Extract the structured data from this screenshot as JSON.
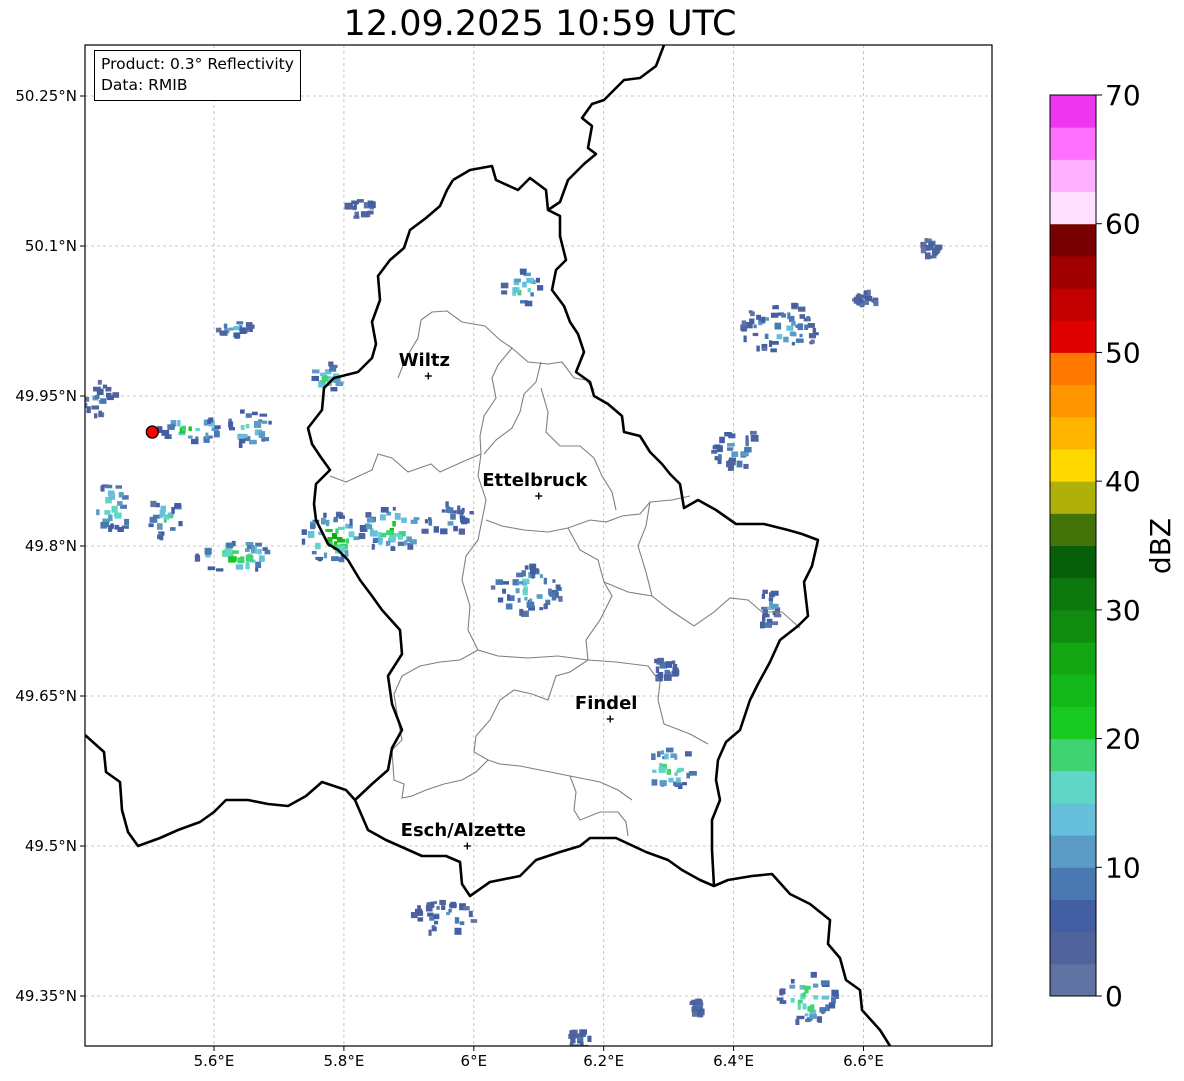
{
  "title": "12.09.2025 10:59 UTC",
  "info": {
    "product": "Product: 0.3° Reflectivity",
    "source": "Data: RMIB"
  },
  "map": {
    "lon_range": [
      5.4,
      6.8
    ],
    "lat_range": [
      49.3,
      50.3
    ],
    "lon_ticks": [
      {
        "value": 5.6,
        "label": "5.6°E"
      },
      {
        "value": 5.8,
        "label": "5.8°E"
      },
      {
        "value": 6.0,
        "label": "6°E"
      },
      {
        "value": 6.2,
        "label": "6.2°E"
      },
      {
        "value": 6.4,
        "label": "6.4°E"
      },
      {
        "value": 6.6,
        "label": "6.6°E"
      }
    ],
    "lat_ticks": [
      {
        "value": 50.25,
        "label": "50.25°N"
      },
      {
        "value": 50.1,
        "label": "50.1°N"
      },
      {
        "value": 49.95,
        "label": "49.95°N"
      },
      {
        "value": 49.8,
        "label": "49.8°N"
      },
      {
        "value": 49.65,
        "label": "49.65°N"
      },
      {
        "value": 49.5,
        "label": "49.5°N"
      },
      {
        "value": 49.35,
        "label": "49.35°N"
      }
    ],
    "grid": true,
    "cities": [
      {
        "name": "Wiltz",
        "lon": 5.93,
        "lat": 49.97
      },
      {
        "name": "Ettelbruck",
        "lon": 6.1,
        "lat": 49.85
      },
      {
        "name": "Findel",
        "lon": 6.21,
        "lat": 49.627
      },
      {
        "name": "Esch/Alzette",
        "lon": 5.99,
        "lat": 49.5
      }
    ],
    "radar_site": {
      "lon": 5.505,
      "lat": 49.914,
      "color": "#ff0000"
    },
    "colors": {
      "border": "#000000",
      "cantons": "#808080",
      "grid": "#bbbbbb"
    }
  },
  "colorbar": {
    "label": "dBZ",
    "min": 0,
    "max": 70,
    "ticks": [
      0,
      10,
      20,
      30,
      40,
      50,
      60,
      70
    ],
    "step": 2.5,
    "colors": [
      "#6173a3",
      "#50639c",
      "#445ea3",
      "#4a78b0",
      "#5a9cc6",
      "#66c0dc",
      "#5fd6c6",
      "#3fd371",
      "#17c920",
      "#13b91a",
      "#12a712",
      "#0f8b0e",
      "#0c780e",
      "#075f0a",
      "#437409",
      "#b0b00a",
      "#ffd800",
      "#ffb400",
      "#ff9600",
      "#ff7800",
      "#e10000",
      "#c30000",
      "#a00000",
      "#780000",
      "#ffe0ff",
      "#ffb0ff",
      "#ff70ff",
      "#ee36ee"
    ]
  },
  "echoes": [
    {
      "lon": 5.42,
      "lat": 49.95,
      "w": 0.05,
      "h": 0.04,
      "intensity": 10
    },
    {
      "lon": 5.56,
      "lat": 49.92,
      "w": 0.1,
      "h": 0.03,
      "intensity": 22
    },
    {
      "lon": 5.65,
      "lat": 49.92,
      "w": 0.08,
      "h": 0.035,
      "intensity": 20
    },
    {
      "lon": 5.63,
      "lat": 50.02,
      "w": 0.06,
      "h": 0.015,
      "intensity": 14
    },
    {
      "lon": 5.77,
      "lat": 49.97,
      "w": 0.05,
      "h": 0.03,
      "intensity": 22
    },
    {
      "lon": 5.44,
      "lat": 49.84,
      "w": 0.06,
      "h": 0.05,
      "intensity": 20
    },
    {
      "lon": 5.52,
      "lat": 49.83,
      "w": 0.06,
      "h": 0.04,
      "intensity": 18
    },
    {
      "lon": 5.63,
      "lat": 49.79,
      "w": 0.12,
      "h": 0.035,
      "intensity": 24
    },
    {
      "lon": 5.78,
      "lat": 49.81,
      "w": 0.1,
      "h": 0.05,
      "intensity": 26
    },
    {
      "lon": 5.87,
      "lat": 49.82,
      "w": 0.1,
      "h": 0.045,
      "intensity": 24
    },
    {
      "lon": 5.96,
      "lat": 49.83,
      "w": 0.08,
      "h": 0.03,
      "intensity": 12
    },
    {
      "lon": 6.07,
      "lat": 50.06,
      "w": 0.06,
      "h": 0.035,
      "intensity": 22
    },
    {
      "lon": 6.08,
      "lat": 49.76,
      "w": 0.11,
      "h": 0.05,
      "intensity": 16
    },
    {
      "lon": 6.47,
      "lat": 50.02,
      "w": 0.12,
      "h": 0.05,
      "intensity": 14
    },
    {
      "lon": 6.4,
      "lat": 49.9,
      "w": 0.08,
      "h": 0.04,
      "intensity": 12
    },
    {
      "lon": 6.45,
      "lat": 49.74,
      "w": 0.03,
      "h": 0.04,
      "intensity": 13
    },
    {
      "lon": 6.3,
      "lat": 49.58,
      "w": 0.08,
      "h": 0.04,
      "intensity": 22
    },
    {
      "lon": 6.29,
      "lat": 49.68,
      "w": 0.04,
      "h": 0.02,
      "intensity": 9
    },
    {
      "lon": 6.7,
      "lat": 50.1,
      "w": 0.03,
      "h": 0.02,
      "intensity": 8
    },
    {
      "lon": 6.6,
      "lat": 50.05,
      "w": 0.04,
      "h": 0.015,
      "intensity": 8
    },
    {
      "lon": 5.95,
      "lat": 49.43,
      "w": 0.1,
      "h": 0.035,
      "intensity": 12
    },
    {
      "lon": 6.51,
      "lat": 49.35,
      "w": 0.09,
      "h": 0.05,
      "intensity": 22
    },
    {
      "lon": 6.34,
      "lat": 49.34,
      "w": 0.02,
      "h": 0.02,
      "intensity": 8
    },
    {
      "lon": 5.82,
      "lat": 50.14,
      "w": 0.05,
      "h": 0.02,
      "intensity": 7
    },
    {
      "lon": 6.16,
      "lat": 49.31,
      "w": 0.04,
      "h": 0.02,
      "intensity": 9
    }
  ]
}
